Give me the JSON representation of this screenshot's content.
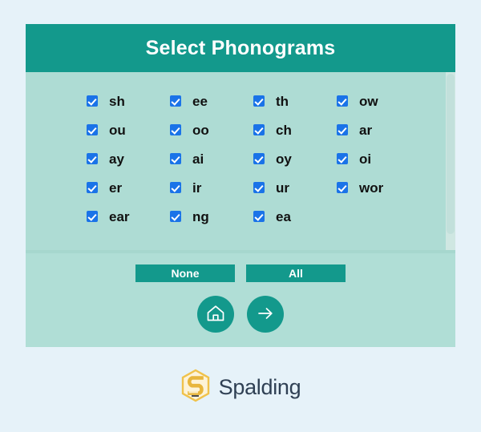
{
  "page": {
    "background_color": "#e6f2f9"
  },
  "header": {
    "title": "Select Phonograms",
    "background_color": "#13998c",
    "text_color": "#ffffff"
  },
  "phonogram_panel": {
    "background_color": "#aedcd4",
    "checkbox_color": "#1a73e8",
    "columns": 4,
    "items": [
      {
        "label": "sh",
        "checked": true
      },
      {
        "label": "ee",
        "checked": true
      },
      {
        "label": "th",
        "checked": true
      },
      {
        "label": "ow",
        "checked": true
      },
      {
        "label": "ou",
        "checked": true
      },
      {
        "label": "oo",
        "checked": true
      },
      {
        "label": "ch",
        "checked": true
      },
      {
        "label": "ar",
        "checked": true
      },
      {
        "label": "ay",
        "checked": true
      },
      {
        "label": "ai",
        "checked": true
      },
      {
        "label": "oy",
        "checked": true
      },
      {
        "label": "oi",
        "checked": true
      },
      {
        "label": "er",
        "checked": true
      },
      {
        "label": "ir",
        "checked": true
      },
      {
        "label": "ur",
        "checked": true
      },
      {
        "label": "wor",
        "checked": true
      },
      {
        "label": "ear",
        "checked": true
      },
      {
        "label": "ng",
        "checked": true
      },
      {
        "label": "ea",
        "checked": true
      }
    ]
  },
  "controls": {
    "none_label": "None",
    "all_label": "All",
    "button_color": "#13998c",
    "home_icon": "home-icon",
    "next_icon": "arrow-right-icon"
  },
  "brand": {
    "name": "Spalding",
    "logo_icon": "spalding-hexagon-logo",
    "logo_color": "#f0c24b",
    "text_color": "#2f4054"
  }
}
